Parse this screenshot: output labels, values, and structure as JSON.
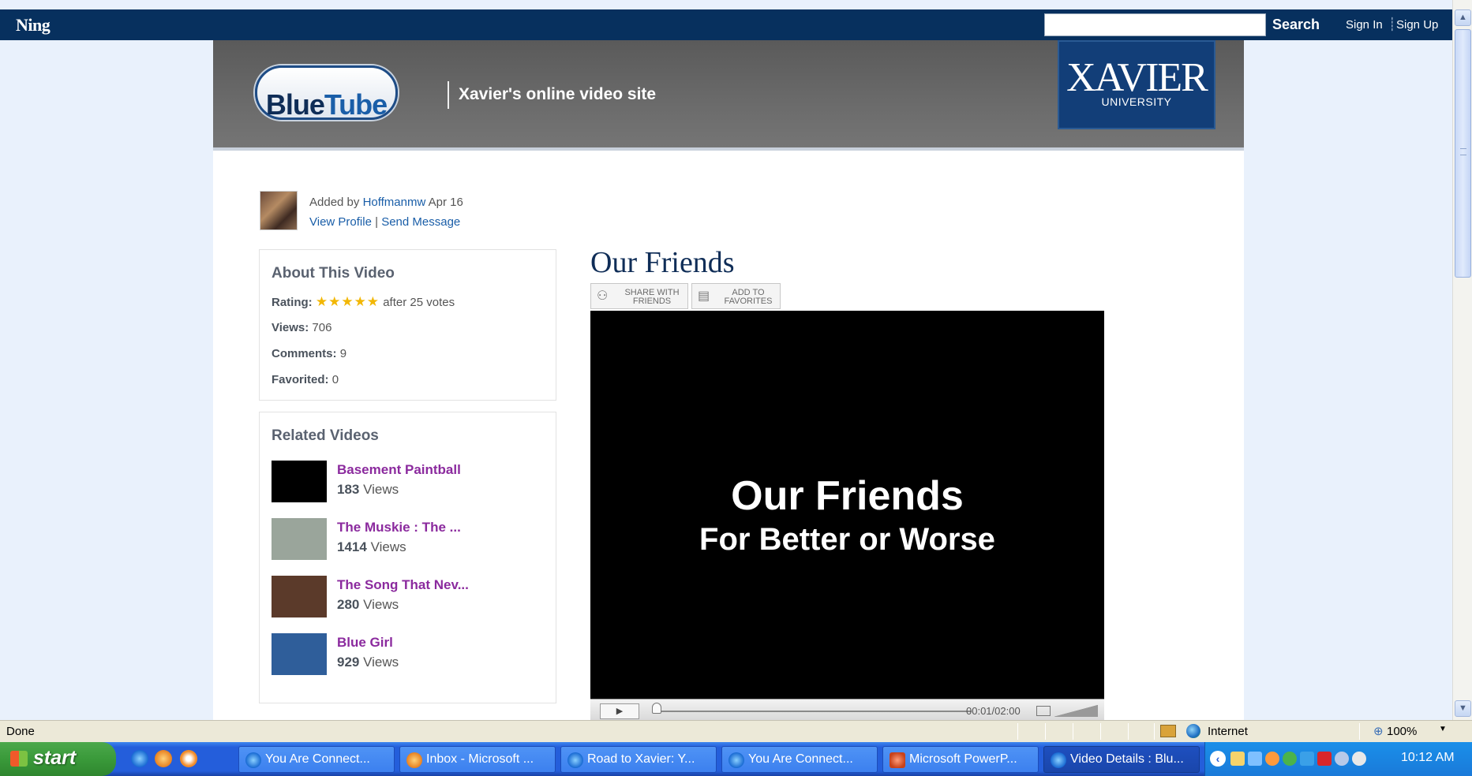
{
  "ning": {
    "logo": "Ning",
    "search_placeholder": "",
    "search_label": "Search",
    "sign_in": "Sign In",
    "sign_up": "Sign Up"
  },
  "header": {
    "logo_part1": "Blue",
    "logo_part2": "Tube",
    "tagline": "Xavier's online video site",
    "school_name": "XAVIER",
    "school_sub": "UNIVERSITY"
  },
  "author": {
    "added_prefix": "Added by",
    "name": "Hoffmanmw",
    "date": "Apr 16",
    "view_profile": "View Profile",
    "separator": "|",
    "send_message": "Send Message"
  },
  "about": {
    "title": "About This Video",
    "rating_label": "Rating:",
    "rating_stars": 5,
    "rating_votes": "after 25 votes",
    "views_label": "Views:",
    "views": "706",
    "comments_label": "Comments:",
    "comments": "9",
    "favorited_label": "Favorited:",
    "favorited": "0"
  },
  "related": {
    "title": "Related Videos",
    "views_word": "Views",
    "items": [
      {
        "title": "Basement Paintball",
        "views": "183",
        "thumb_color": "#000000"
      },
      {
        "title": "The Muskie : The ...",
        "views": "1414",
        "thumb_color": "#9aa59b"
      },
      {
        "title": "The Song That Nev...",
        "views": "280",
        "thumb_color": "#5b3a2a"
      },
      {
        "title": "Blue Girl",
        "views": "929",
        "thumb_color": "#2f5e9a"
      }
    ]
  },
  "video": {
    "title": "Our Friends",
    "share_label": "SHARE WITH FRIENDS",
    "favorites_label": "ADD TO FAVORITES",
    "screen_title": "Our Friends",
    "screen_subtitle": "For Better or Worse",
    "timecode": "00:01/02:00"
  },
  "statusbar": {
    "status": "Done",
    "zone": "Internet",
    "zoom": "100%"
  },
  "taskbar": {
    "start": "start",
    "tasks": [
      {
        "label": "You Are Connect...",
        "icon": "ie",
        "active": false
      },
      {
        "label": "Inbox - Microsoft ...",
        "icon": "outlook",
        "active": false
      },
      {
        "label": "Road to Xavier: Y...",
        "icon": "ie",
        "active": false
      },
      {
        "label": "You Are Connect...",
        "icon": "ie",
        "active": false
      },
      {
        "label": "Microsoft PowerP...",
        "icon": "powerpoint",
        "active": false
      },
      {
        "label": "Video Details : Blu...",
        "icon": "ie",
        "active": true
      }
    ],
    "clock": "10:12 AM"
  },
  "colors": {
    "ning_bar": "#07305e",
    "link": "#1a5ea8",
    "related_title": "#8b2a9e",
    "video_title": "#0f2d57",
    "star": "#f2b705"
  }
}
